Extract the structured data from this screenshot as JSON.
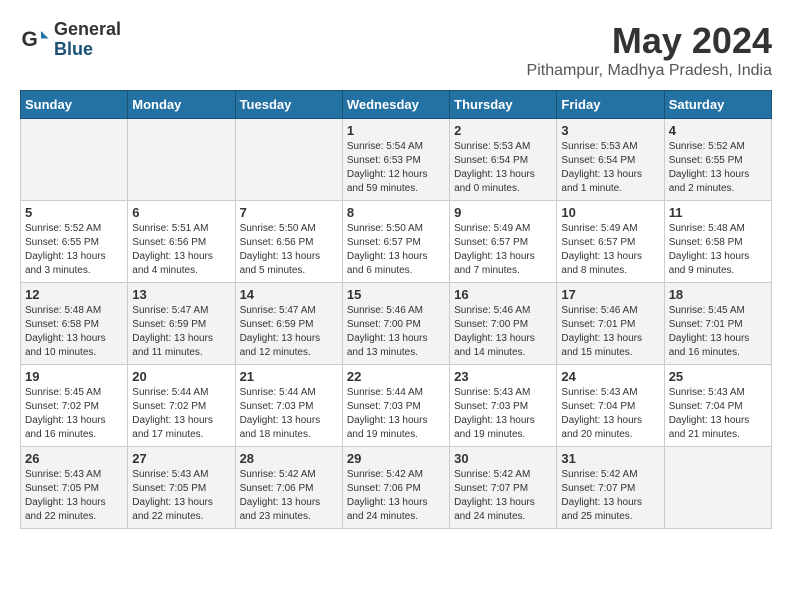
{
  "header": {
    "logo_general": "General",
    "logo_blue": "Blue",
    "title": "May 2024",
    "location": "Pithampur, Madhya Pradesh, India"
  },
  "weekdays": [
    "Sunday",
    "Monday",
    "Tuesday",
    "Wednesday",
    "Thursday",
    "Friday",
    "Saturday"
  ],
  "weeks": [
    [
      {
        "day": "",
        "info": ""
      },
      {
        "day": "",
        "info": ""
      },
      {
        "day": "",
        "info": ""
      },
      {
        "day": "1",
        "info": "Sunrise: 5:54 AM\nSunset: 6:53 PM\nDaylight: 12 hours\nand 59 minutes."
      },
      {
        "day": "2",
        "info": "Sunrise: 5:53 AM\nSunset: 6:54 PM\nDaylight: 13 hours\nand 0 minutes."
      },
      {
        "day": "3",
        "info": "Sunrise: 5:53 AM\nSunset: 6:54 PM\nDaylight: 13 hours\nand 1 minute."
      },
      {
        "day": "4",
        "info": "Sunrise: 5:52 AM\nSunset: 6:55 PM\nDaylight: 13 hours\nand 2 minutes."
      }
    ],
    [
      {
        "day": "5",
        "info": "Sunrise: 5:52 AM\nSunset: 6:55 PM\nDaylight: 13 hours\nand 3 minutes."
      },
      {
        "day": "6",
        "info": "Sunrise: 5:51 AM\nSunset: 6:56 PM\nDaylight: 13 hours\nand 4 minutes."
      },
      {
        "day": "7",
        "info": "Sunrise: 5:50 AM\nSunset: 6:56 PM\nDaylight: 13 hours\nand 5 minutes."
      },
      {
        "day": "8",
        "info": "Sunrise: 5:50 AM\nSunset: 6:57 PM\nDaylight: 13 hours\nand 6 minutes."
      },
      {
        "day": "9",
        "info": "Sunrise: 5:49 AM\nSunset: 6:57 PM\nDaylight: 13 hours\nand 7 minutes."
      },
      {
        "day": "10",
        "info": "Sunrise: 5:49 AM\nSunset: 6:57 PM\nDaylight: 13 hours\nand 8 minutes."
      },
      {
        "day": "11",
        "info": "Sunrise: 5:48 AM\nSunset: 6:58 PM\nDaylight: 13 hours\nand 9 minutes."
      }
    ],
    [
      {
        "day": "12",
        "info": "Sunrise: 5:48 AM\nSunset: 6:58 PM\nDaylight: 13 hours\nand 10 minutes."
      },
      {
        "day": "13",
        "info": "Sunrise: 5:47 AM\nSunset: 6:59 PM\nDaylight: 13 hours\nand 11 minutes."
      },
      {
        "day": "14",
        "info": "Sunrise: 5:47 AM\nSunset: 6:59 PM\nDaylight: 13 hours\nand 12 minutes."
      },
      {
        "day": "15",
        "info": "Sunrise: 5:46 AM\nSunset: 7:00 PM\nDaylight: 13 hours\nand 13 minutes."
      },
      {
        "day": "16",
        "info": "Sunrise: 5:46 AM\nSunset: 7:00 PM\nDaylight: 13 hours\nand 14 minutes."
      },
      {
        "day": "17",
        "info": "Sunrise: 5:46 AM\nSunset: 7:01 PM\nDaylight: 13 hours\nand 15 minutes."
      },
      {
        "day": "18",
        "info": "Sunrise: 5:45 AM\nSunset: 7:01 PM\nDaylight: 13 hours\nand 16 minutes."
      }
    ],
    [
      {
        "day": "19",
        "info": "Sunrise: 5:45 AM\nSunset: 7:02 PM\nDaylight: 13 hours\nand 16 minutes."
      },
      {
        "day": "20",
        "info": "Sunrise: 5:44 AM\nSunset: 7:02 PM\nDaylight: 13 hours\nand 17 minutes."
      },
      {
        "day": "21",
        "info": "Sunrise: 5:44 AM\nSunset: 7:03 PM\nDaylight: 13 hours\nand 18 minutes."
      },
      {
        "day": "22",
        "info": "Sunrise: 5:44 AM\nSunset: 7:03 PM\nDaylight: 13 hours\nand 19 minutes."
      },
      {
        "day": "23",
        "info": "Sunrise: 5:43 AM\nSunset: 7:03 PM\nDaylight: 13 hours\nand 19 minutes."
      },
      {
        "day": "24",
        "info": "Sunrise: 5:43 AM\nSunset: 7:04 PM\nDaylight: 13 hours\nand 20 minutes."
      },
      {
        "day": "25",
        "info": "Sunrise: 5:43 AM\nSunset: 7:04 PM\nDaylight: 13 hours\nand 21 minutes."
      }
    ],
    [
      {
        "day": "26",
        "info": "Sunrise: 5:43 AM\nSunset: 7:05 PM\nDaylight: 13 hours\nand 22 minutes."
      },
      {
        "day": "27",
        "info": "Sunrise: 5:43 AM\nSunset: 7:05 PM\nDaylight: 13 hours\nand 22 minutes."
      },
      {
        "day": "28",
        "info": "Sunrise: 5:42 AM\nSunset: 7:06 PM\nDaylight: 13 hours\nand 23 minutes."
      },
      {
        "day": "29",
        "info": "Sunrise: 5:42 AM\nSunset: 7:06 PM\nDaylight: 13 hours\nand 24 minutes."
      },
      {
        "day": "30",
        "info": "Sunrise: 5:42 AM\nSunset: 7:07 PM\nDaylight: 13 hours\nand 24 minutes."
      },
      {
        "day": "31",
        "info": "Sunrise: 5:42 AM\nSunset: 7:07 PM\nDaylight: 13 hours\nand 25 minutes."
      },
      {
        "day": "",
        "info": ""
      }
    ]
  ]
}
